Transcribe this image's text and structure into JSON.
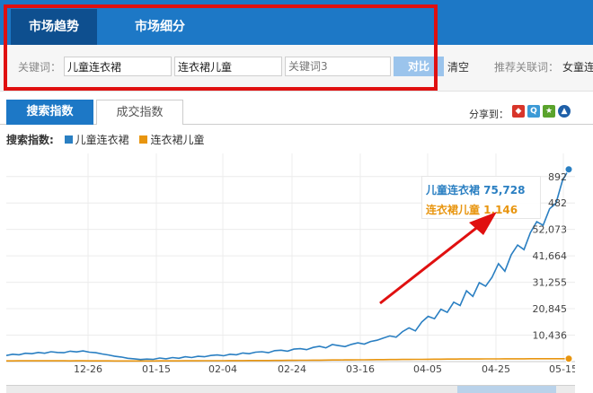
{
  "topnav": {
    "tabs": [
      {
        "label": "市场趋势",
        "active": true
      },
      {
        "label": "市场细分",
        "active": false
      }
    ]
  },
  "keywords": {
    "label": "关键词：",
    "kw1": "儿童连衣裙",
    "kw2": "连衣裙儿童",
    "kw3_placeholder": "关键词3",
    "compare_button": "对比",
    "clear_link": "清空",
    "recommend_label": "推荐关联词：",
    "recommend_item": "女童连"
  },
  "subtabs": [
    {
      "label": "搜索指数",
      "active": true
    },
    {
      "label": "成交指数",
      "active": false
    }
  ],
  "share": {
    "label": "分享到：",
    "icons": [
      "share-icon-a",
      "share-icon-b",
      "share-icon-c",
      "share-icon-d"
    ]
  },
  "legend": {
    "title": "搜索指数:",
    "series": [
      {
        "name": "儿童连衣裙",
        "color": "#2a7fc2"
      },
      {
        "name": "连衣裙儿童",
        "color": "#e8950f"
      }
    ]
  },
  "tooltip": {
    "line1": "儿童连衣裙 75,728",
    "line2": "连衣裙儿童 1,146"
  },
  "chart_data": {
    "type": "line",
    "x_ticks": [
      "12-26",
      "01-15",
      "02-04",
      "02-24",
      "03-16",
      "04-05",
      "04-25",
      "05-15"
    ],
    "y_ticks": [
      10436,
      20845,
      31255,
      41664,
      52073,
      62482,
      72892
    ],
    "y_tick_labels": [
      "10,436",
      "20,845",
      "31,255",
      "41,664",
      "52,073",
      "482",
      "892"
    ],
    "ylim": [
      0,
      82000
    ],
    "grid": true,
    "series": [
      {
        "name": "儿童连衣裙",
        "color": "#2a7fc2",
        "values": [
          2400,
          2900,
          2700,
          3300,
          3100,
          3600,
          3300,
          3900,
          3600,
          3500,
          4100,
          3800,
          4200,
          3700,
          3500,
          3000,
          2600,
          2100,
          1800,
          1300,
          1100,
          800,
          1000,
          900,
          1400,
          1100,
          1600,
          1300,
          1900,
          1600,
          2100,
          1900,
          2400,
          2600,
          2300,
          2900,
          2700,
          3400,
          3100,
          3700,
          3900,
          3500,
          4300,
          4500,
          4100,
          4900,
          5100,
          4700,
          5600,
          6000,
          5400,
          6700,
          6300,
          5900,
          6800,
          7400,
          6900,
          7900,
          8400,
          9300,
          10100,
          9600,
          11800,
          13300,
          12100,
          15600,
          17800,
          16900,
          20600,
          19400,
          23400,
          22100,
          27900,
          25700,
          31100,
          29700,
          33200,
          38600,
          35600,
          42100,
          45900,
          44100,
          50800,
          55100,
          53700,
          60200,
          62400,
          71200,
          75728
        ]
      },
      {
        "name": "连衣裙儿童",
        "color": "#e8950f",
        "values": [
          300,
          300,
          320,
          310,
          330,
          310,
          340,
          320,
          330,
          310,
          300,
          320,
          310,
          300,
          290,
          280,
          270,
          260,
          250,
          240,
          230,
          240,
          250,
          260,
          270,
          280,
          290,
          300,
          310,
          320,
          330,
          340,
          350,
          360,
          370,
          380,
          390,
          400,
          410,
          420,
          430,
          440,
          450,
          460,
          480,
          500,
          520,
          540,
          560,
          580,
          600,
          620,
          640,
          660,
          680,
          700,
          720,
          740,
          760,
          780,
          800,
          820,
          840,
          860,
          880,
          900,
          920,
          940,
          960,
          980,
          1000,
          1010,
          1020,
          1030,
          1040,
          1050,
          1060,
          1070,
          1080,
          1090,
          1100,
          1110,
          1115,
          1120,
          1125,
          1130,
          1135,
          1140,
          1146
        ]
      }
    ]
  }
}
